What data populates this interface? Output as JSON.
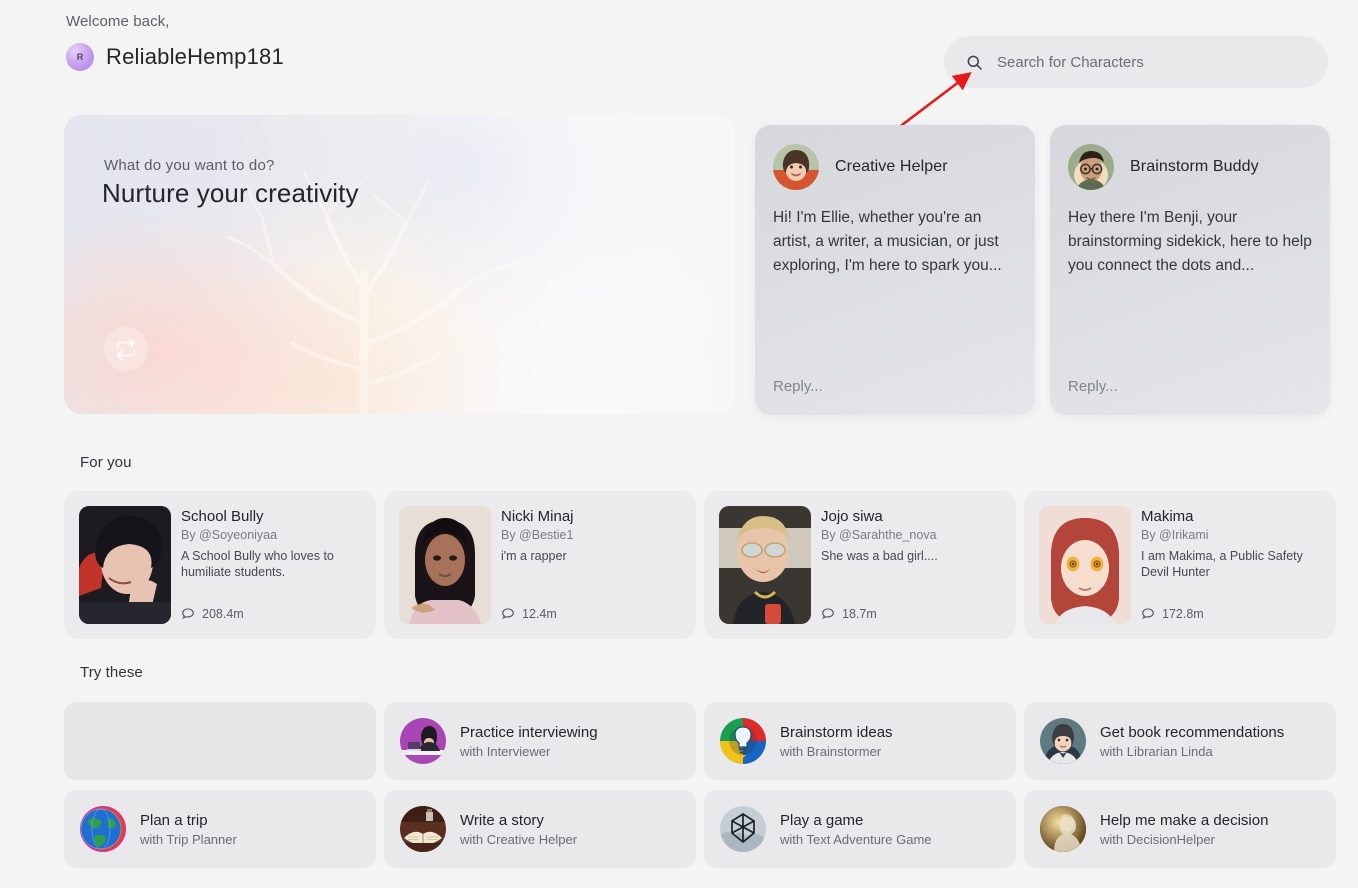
{
  "header": {
    "welcome_text": "Welcome back,",
    "username": "ReliableHemp181",
    "avatar_initial": "R",
    "avatar_color": "#c9a4f0"
  },
  "search": {
    "placeholder": "Search for Characters",
    "icon": "search-icon"
  },
  "annotation": {
    "type": "arrow",
    "color": "#e8191b",
    "points_to": "search-icon"
  },
  "hero": {
    "question": "What do you want to do?",
    "title": "Nurture your creativity",
    "shuffle_icon": "refresh-icon"
  },
  "chat_cards": [
    {
      "name": "Creative Helper",
      "greeting": "Hi! I'm Ellie, whether you're an artist, a writer, a musician, or just exploring, I'm here to spark you...",
      "reply_placeholder": "Reply...",
      "avatar": "woman-brown-hair-orange-top"
    },
    {
      "name": "Brainstorm Buddy",
      "greeting": "Hey there I'm Benji, your brainstorming sidekick, here to help you connect the dots and...",
      "reply_placeholder": "Reply...",
      "avatar": "man-glasses-green-background"
    }
  ],
  "for_you": {
    "section_title": "For you",
    "cards": [
      {
        "name": "School Bully",
        "author": "By @Soyeoniyaa",
        "description": "A School Bully who loves to humiliate students.",
        "chats": "208.4m",
        "thumb": "anime-dark-haired-boy-red-accent"
      },
      {
        "name": "Nicki Minaj",
        "author": "By @Bestie1",
        "description": "i'm a rapper",
        "chats": "12.4m",
        "thumb": "photo-woman-long-black-hair"
      },
      {
        "name": "Jojo siwa",
        "author": "By @Sarahthe_nova",
        "description": "She was a bad girl....",
        "chats": "18.7m",
        "thumb": "photo-blonde-woman-sunglasses"
      },
      {
        "name": "Makima",
        "author": "By @Irikami",
        "description": "I am Makima, a Public Safety Devil Hunter",
        "chats": "172.8m",
        "thumb": "anime-red-haired-woman-yellow-eyes"
      }
    ]
  },
  "try_these": {
    "section_title": "Try these",
    "cards": [
      {
        "empty": true,
        "title": "",
        "subtitle": "",
        "avatar": ""
      },
      {
        "empty": false,
        "title": "Practice interviewing",
        "subtitle": "with Interviewer",
        "avatar": "purple-interview-desk"
      },
      {
        "empty": false,
        "title": "Brainstorm ideas",
        "subtitle": "with Brainstormer",
        "avatar": "colorful-lightbulb"
      },
      {
        "empty": false,
        "title": "Get book recommendations",
        "subtitle": "with Librarian Linda",
        "avatar": "librarian-portrait"
      },
      {
        "empty": false,
        "title": "Plan a trip",
        "subtitle": "with Trip Planner",
        "avatar": "rainbow-globe"
      },
      {
        "empty": false,
        "title": "Write a story",
        "subtitle": "with Creative Helper",
        "avatar": "open-book-desk"
      },
      {
        "empty": false,
        "title": "Play a game",
        "subtitle": "with Text Adventure Game",
        "avatar": "shield-emblem"
      },
      {
        "empty": false,
        "title": "Help me make a decision",
        "subtitle": "with DecisionHelper",
        "avatar": "golden-silhouette"
      }
    ]
  },
  "theme": {
    "page_background": "#f4f4f5",
    "card_background": "#ebebed",
    "text_primary": "#24242a",
    "text_secondary": "#6c6c74",
    "accent_annotation": "#e8191b"
  }
}
